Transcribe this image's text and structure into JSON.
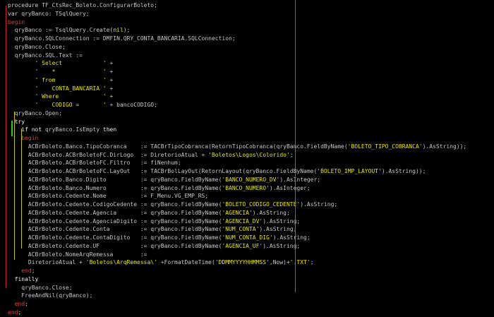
{
  "editor": {
    "colors": {
      "background": "#000000",
      "text": "#c8c8c8",
      "keyword": "#f0f0f0",
      "string": "#e8e800",
      "keyword_red_accent": "#e04040",
      "gutter_red": "#c0281e",
      "gutter_green": "#19d219",
      "right_margin": "#6a6a6a",
      "fold_line": "#bfbf30"
    },
    "lines": [
      [
        [
          "kw",
          "procedure "
        ],
        [
          "tx",
          "TF_CtsRec_Boleto.ConfigurarBoleto;"
        ]
      ],
      [
        [
          "kw",
          "var "
        ],
        [
          "tx",
          "qryBanco: TSqlQuery;"
        ]
      ],
      [
        [
          "kw",
          "begin"
        ]
      ],
      [
        [
          "tx",
          "  qryBanco := TsqlQuery.Create("
        ],
        [
          "nil",
          "nil"
        ],
        [
          "tx",
          ");"
        ]
      ],
      [
        [
          "tx",
          "  qryBanco.SQLConnection := DMFIN.QRY_CONTA_BANCARIA.SQLConnection;"
        ]
      ],
      [
        [
          "tx",
          "  qryBanco.Close;"
        ]
      ],
      [
        [
          "tx",
          "  qryBanco.SQL.Text :="
        ]
      ],
      [
        [
          "tx",
          "        "
        ],
        [
          "st",
          "' Select            '"
        ],
        [
          "tx",
          " +"
        ]
      ],
      [
        [
          "tx",
          "        "
        ],
        [
          "st",
          "'    *              '"
        ],
        [
          "tx",
          " +"
        ]
      ],
      [
        [
          "tx",
          "        "
        ],
        [
          "st",
          "' from              '"
        ],
        [
          "tx",
          " +"
        ]
      ],
      [
        [
          "tx",
          "        "
        ],
        [
          "st",
          "'    CONTA_BANCARIA '"
        ],
        [
          "tx",
          " +"
        ]
      ],
      [
        [
          "tx",
          "        "
        ],
        [
          "st",
          "' Where             '"
        ],
        [
          "tx",
          " +"
        ]
      ],
      [
        [
          "tx",
          "        "
        ],
        [
          "st",
          "'    CODIGO =       '"
        ],
        [
          "tx",
          " + bancoCODIGO;"
        ]
      ],
      [
        [
          "tx",
          "  qryBanco.Open;"
        ]
      ],
      [
        [
          "tx",
          "  "
        ],
        [
          "kw",
          "try"
        ]
      ],
      [
        [
          "tx",
          "    "
        ],
        [
          "kw",
          "if not "
        ],
        [
          "tx",
          "qryBanco.IsEmpty "
        ],
        [
          "kw",
          "then"
        ]
      ],
      [
        [
          "tx",
          "    "
        ],
        [
          "kw",
          "begin"
        ]
      ],
      [
        [
          "tx",
          "      ACBrBoleto.Banco.TipoCobranca    := TACBrTipoCobranca(RetornTipoCobranca(qryBanco.FieldByName("
        ],
        [
          "st",
          "'BOLETO_TIPO_COBRANCA'"
        ],
        [
          "tx",
          ").AsString));"
        ]
      ],
      [
        [
          "tx",
          "      ACBrBoleto.ACBrBoletoFC.DirLogo  := DiretorioAtual + "
        ],
        [
          "st",
          "'Boletos\\Logos\\Colorido'"
        ],
        [
          "tx",
          ";"
        ]
      ],
      [
        [
          "tx",
          "      ACBrBoleto.ACBrBoletoFC.Filtro   := fiNenhum;"
        ]
      ],
      [
        [
          "tx",
          "      ACBrBoleto.ACBrBoletoFC.LayOut   := TACBrBolLayOut(RetornLayout(qryBanco.FieldByName("
        ],
        [
          "st",
          "'BOLETO_IMP_LAYOUT'"
        ],
        [
          "tx",
          ").AsString));"
        ]
      ],
      [
        [
          "tx",
          "      ACBrBoleto.Banco.Digito          := qryBanco.FieldByName("
        ],
        [
          "st",
          "'BANCO_NUMERO_DV'"
        ],
        [
          "tx",
          ").AsInteger;"
        ]
      ],
      [
        [
          "tx",
          "      ACBrBoleto.Banco.Numero          := qryBanco.FieldByName("
        ],
        [
          "st",
          "'BANCO_NUMERO'"
        ],
        [
          "tx",
          ").AsInteger;"
        ]
      ],
      [
        [
          "tx",
          "      ACBrBoleto.Cedente.Nome          := F_Menu.VG_EMP_RS;"
        ]
      ],
      [
        [
          "tx",
          "      ACBrBoleto.Cedente.CodigoCedente := qryBanco.FieldByName("
        ],
        [
          "st",
          "'BOLETO_CODIGO_CEDENTE'"
        ],
        [
          "tx",
          ").AsString;"
        ]
      ],
      [
        [
          "tx",
          "      ACBrBoleto.Cedente.Agencia       := qryBanco.FieldByName("
        ],
        [
          "st",
          "'AGENCIA'"
        ],
        [
          "tx",
          ").AsString;"
        ]
      ],
      [
        [
          "tx",
          "      ACBrBoleto.Cedente.AgenciaDigito := qryBanco.FieldByName("
        ],
        [
          "st",
          "'AGENCIA_DV'"
        ],
        [
          "tx",
          ").AsString;"
        ]
      ],
      [
        [
          "tx",
          "      ACBrBoleto.Cedente.Conta         := qryBanco.FieldByName("
        ],
        [
          "st",
          "'NUM_CONTA'"
        ],
        [
          "tx",
          ").AsString;"
        ]
      ],
      [
        [
          "tx",
          "      ACBrBoleto.Cedente.ContaDigito   := qryBanco.FieldByName("
        ],
        [
          "st",
          "'NUM_CONTA_DIG'"
        ],
        [
          "tx",
          ").AsString;"
        ]
      ],
      [
        [
          "tx",
          "      ACBrBoleto.Cedente.UF            := qryBanco.FieldByName("
        ],
        [
          "st",
          "'AGENCIA_UF'"
        ],
        [
          "tx",
          ").AsString;"
        ]
      ],
      [
        [
          "tx",
          "      ACBrBoleto.NomeArqRemessa        :="
        ]
      ],
      [
        [
          "tx",
          "      DiretorioAtual + "
        ],
        [
          "st",
          "'Boletos\\ArqRemessa\\'"
        ],
        [
          "tx",
          " +FormatDateTime("
        ],
        [
          "st",
          "'DDMMYYYYHHMMSS'"
        ],
        [
          "tx",
          ",Now)+"
        ],
        [
          "st",
          "'.TXT'"
        ],
        [
          "tx",
          ";"
        ]
      ],
      [
        [
          "tx",
          "    "
        ],
        [
          "kw",
          "end"
        ],
        [
          "tx",
          ";"
        ]
      ],
      [
        [
          "tx",
          "  "
        ],
        [
          "kw",
          "finally"
        ]
      ],
      [
        [
          "tx",
          "    qryBanco.Close;"
        ]
      ],
      [
        [
          "tx",
          "    FreeAndNil(qryBanco);"
        ]
      ],
      [
        [
          "tx",
          "  "
        ],
        [
          "kw",
          "end"
        ],
        [
          "tx",
          ";"
        ]
      ],
      [
        [
          "kw",
          "end"
        ],
        [
          "tx",
          ";"
        ]
      ]
    ]
  }
}
